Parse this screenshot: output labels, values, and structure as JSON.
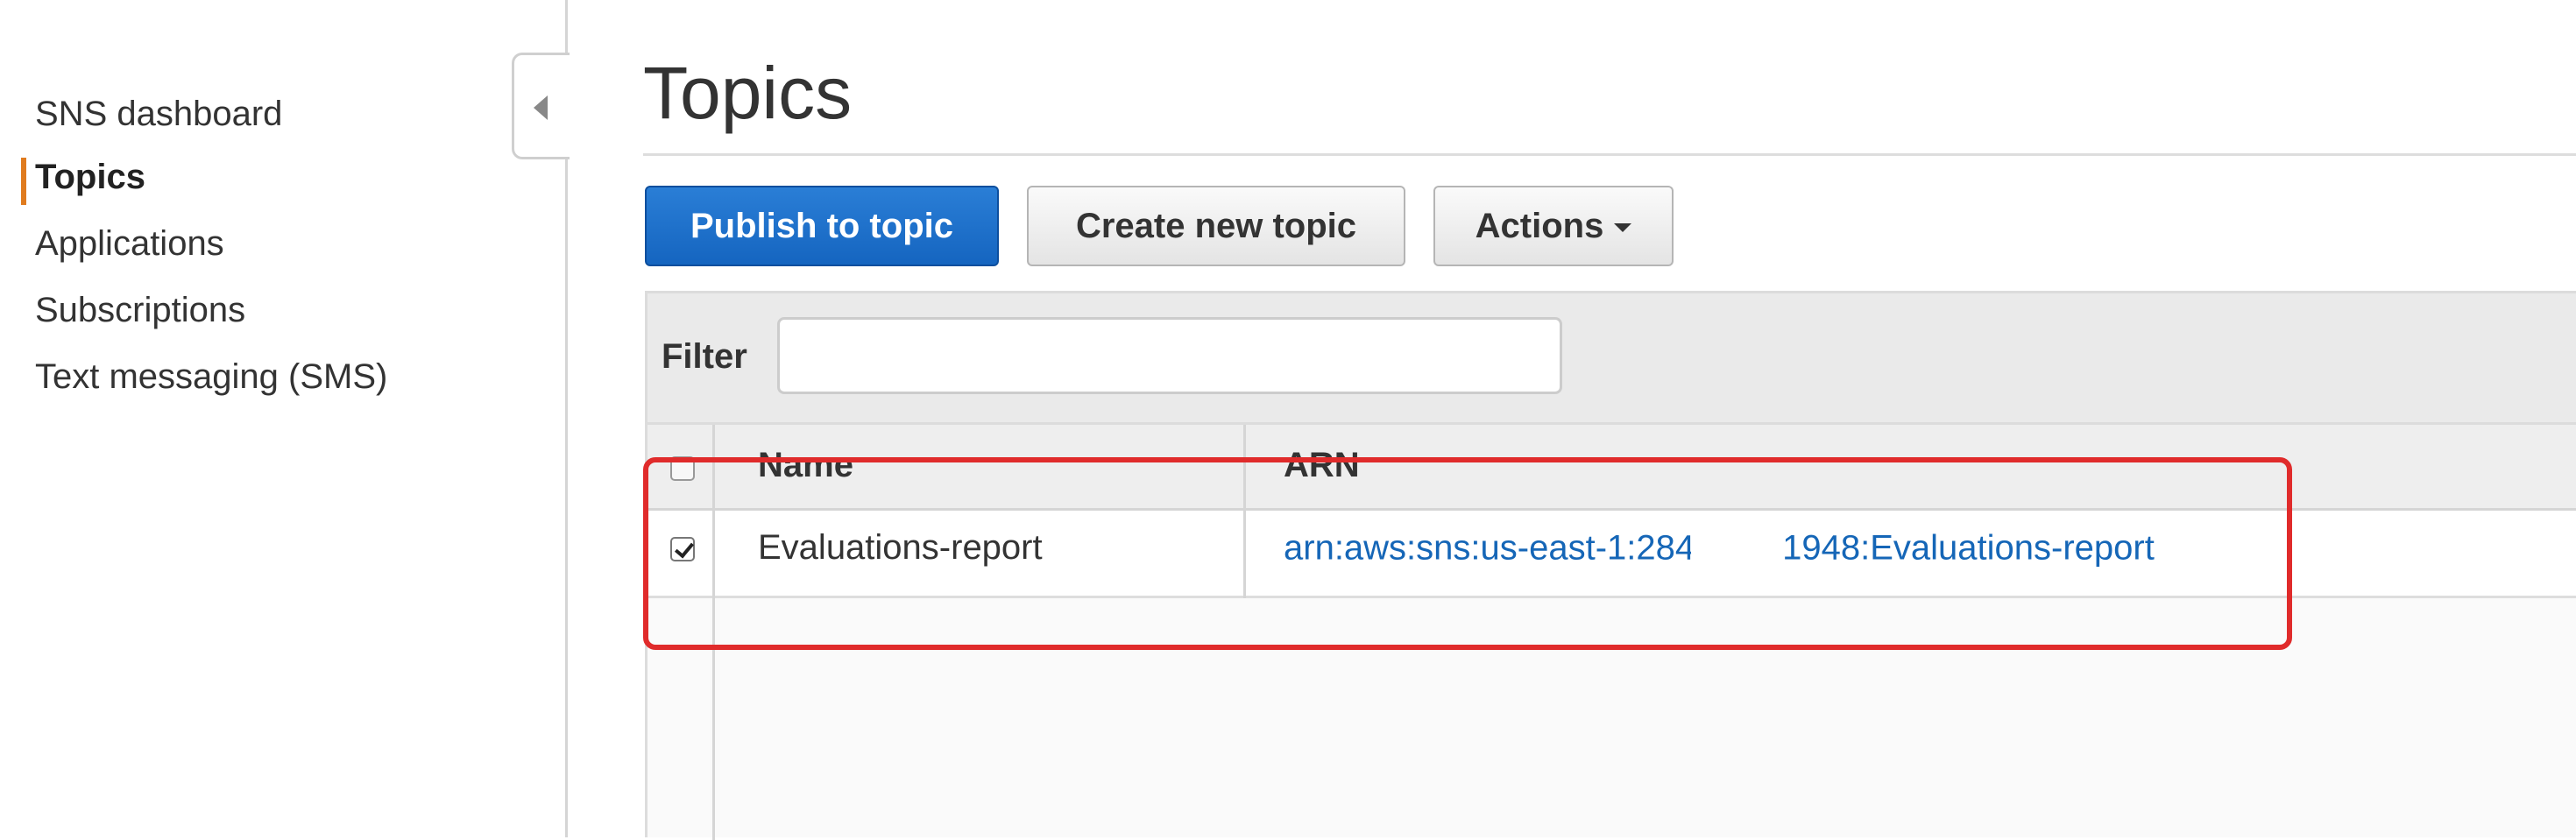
{
  "sidebar": {
    "items": [
      {
        "label": "SNS dashboard",
        "active": false
      },
      {
        "label": "Topics",
        "active": true
      },
      {
        "label": "Applications",
        "active": false
      },
      {
        "label": "Subscriptions",
        "active": false
      },
      {
        "label": "Text messaging (SMS)",
        "active": false
      }
    ],
    "collapse_icon": "chevron-left-icon"
  },
  "page": {
    "title": "Topics"
  },
  "toolbar": {
    "publish_label": "Publish to topic",
    "create_label": "Create new topic",
    "actions_label": "Actions",
    "actions_icon": "caret-down-icon"
  },
  "filter": {
    "label": "Filter",
    "value": "",
    "placeholder": ""
  },
  "table": {
    "columns": [
      "Name",
      "ARN"
    ],
    "rows": [
      {
        "selected": true,
        "name": "Evaluations-report",
        "arn_prefix": "arn:aws:sns:us-east-1:284",
        "arn_suffix": "1948:Evaluations-report"
      }
    ]
  },
  "colors": {
    "primary_button": "#1e72cc",
    "active_nav_indicator": "#e07b1e",
    "link": "#1566b7",
    "highlight_box": "#e02b2b"
  }
}
